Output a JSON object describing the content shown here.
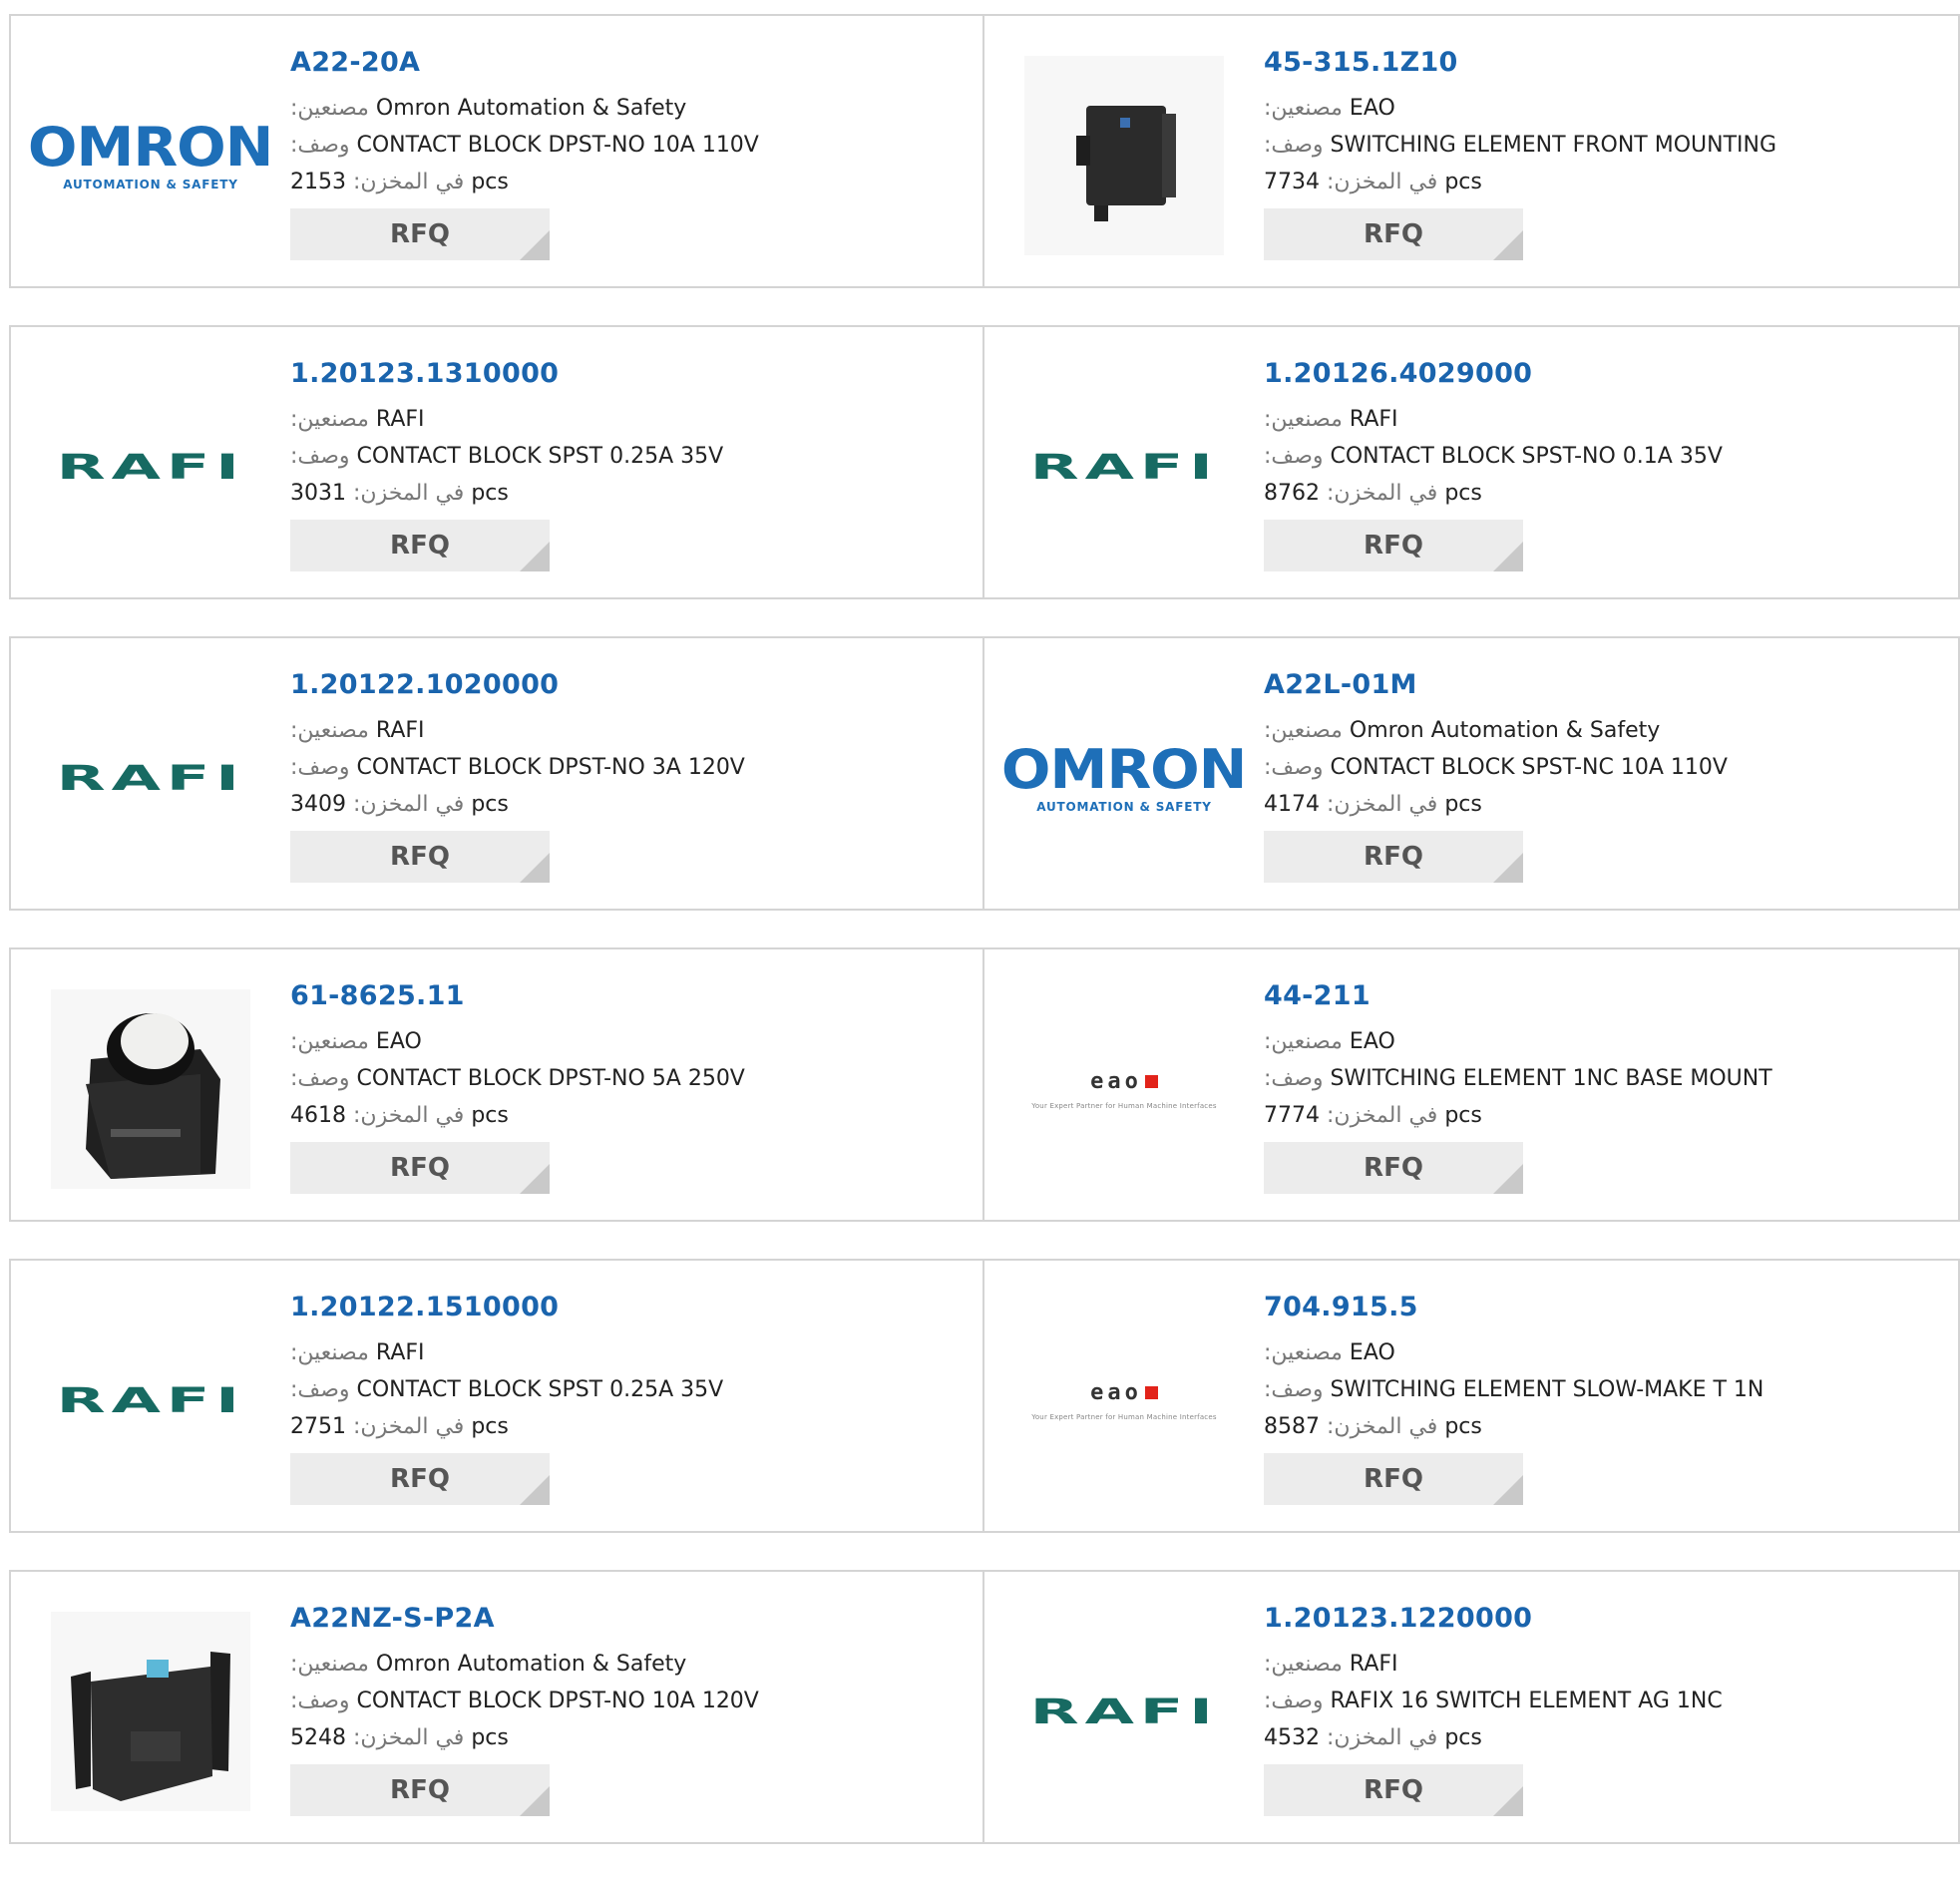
{
  "labels": {
    "manufacturer": ":مصنعين",
    "description": ":وصف",
    "in_stock": ":في المخزن",
    "unit": "pcs",
    "rfq": "RFQ"
  },
  "logos": {
    "omron": {
      "word": "OMRON",
      "sub": "AUTOMATION & SAFETY",
      "color": "#1e6fb8"
    },
    "rafi": {
      "word": "RAFI",
      "color": "#176a62"
    },
    "eao": {
      "word": "eao",
      "sub": "Your Expert Partner for Human Machine Interfaces",
      "accent": "#e2231a"
    }
  },
  "products": [
    {
      "part": "A22-20A",
      "manufacturer": "Omron Automation & Safety",
      "description": "CONTACT BLOCK DPST-NO 10A 110V",
      "stock": "2153",
      "image": "omron-logo"
    },
    {
      "part": "45-315.1Z10",
      "manufacturer": "EAO",
      "description": "SWITCHING ELEMENT FRONT MOUNTING",
      "stock": "7734",
      "image": "switch-element-photo"
    },
    {
      "part": "1.20123.1310000",
      "manufacturer": "RAFI",
      "description": "CONTACT BLOCK SPST 0.25A 35V",
      "stock": "3031",
      "image": "rafi-logo"
    },
    {
      "part": "1.20126.4029000",
      "manufacturer": "RAFI",
      "description": "CONTACT BLOCK SPST-NO 0.1A 35V",
      "stock": "8762",
      "image": "rafi-logo"
    },
    {
      "part": "1.20122.1020000",
      "manufacturer": "RAFI",
      "description": "CONTACT BLOCK DPST-NO 3A 120V",
      "stock": "3409",
      "image": "rafi-logo"
    },
    {
      "part": "A22L-01M",
      "manufacturer": "Omron Automation & Safety",
      "description": "CONTACT BLOCK SPST-NC 10A 110V",
      "stock": "4174",
      "image": "omron-logo"
    },
    {
      "part": "61-8625.11",
      "manufacturer": "EAO",
      "description": "CONTACT BLOCK DPST-NO 5A 250V",
      "stock": "4618",
      "image": "contact-block-photo"
    },
    {
      "part": "44-211",
      "manufacturer": "EAO",
      "description": "SWITCHING ELEMENT 1NC BASE MOUNT",
      "stock": "7774",
      "image": "eao-logo"
    },
    {
      "part": "1.20122.1510000",
      "manufacturer": "RAFI",
      "description": "CONTACT BLOCK SPST 0.25A 35V",
      "stock": "2751",
      "image": "rafi-logo"
    },
    {
      "part": "704.915.5",
      "manufacturer": "EAO",
      "description": "SWITCHING ELEMENT SLOW-MAKE T 1N",
      "stock": "8587",
      "image": "eao-logo"
    },
    {
      "part": "A22NZ-S-P2A",
      "manufacturer": "Omron Automation & Safety",
      "description": "CONTACT BLOCK DPST-NO 10A 120V",
      "stock": "5248",
      "image": "a22nz-block-photo"
    },
    {
      "part": "1.20123.1220000",
      "manufacturer": "RAFI",
      "description": "RAFIX 16 SWITCH ELEMENT AG 1NC",
      "stock": "4532",
      "image": "rafi-logo"
    }
  ]
}
